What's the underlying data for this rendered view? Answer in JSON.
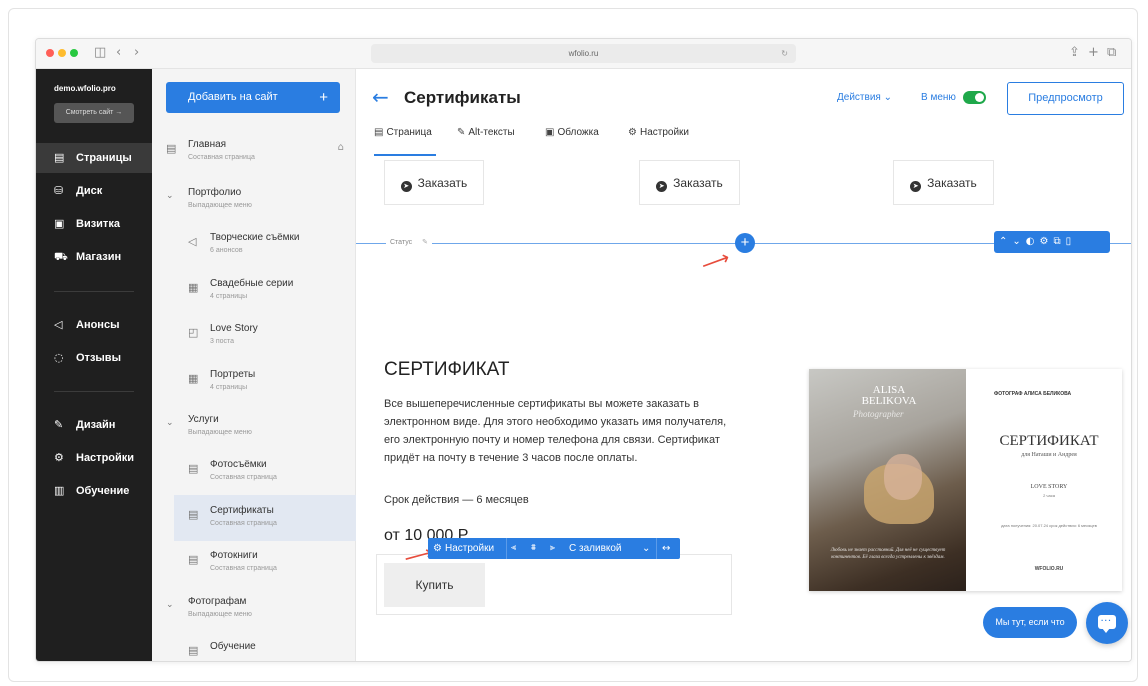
{
  "browser": {
    "url": "wfolio.ru",
    "reload_icon": "reload-icon"
  },
  "sidebar": {
    "domain": "demo.wfolio.pro",
    "view_site": "Смотреть сайт →",
    "nav": [
      {
        "label": "Страницы",
        "icon": "▤"
      },
      {
        "label": "Диск",
        "icon": "⛁"
      },
      {
        "label": "Визитка",
        "icon": "▣"
      },
      {
        "label": "Магазин",
        "icon": "⛟"
      },
      {
        "label": "Анонсы",
        "icon": "◁"
      },
      {
        "label": "Отзывы",
        "icon": "◌"
      },
      {
        "label": "Дизайн",
        "icon": "✎"
      },
      {
        "label": "Настройки",
        "icon": "⚙"
      },
      {
        "label": "Обучение",
        "icon": "▥"
      }
    ]
  },
  "pages": {
    "add_button": "Добавить на сайт",
    "add_plus": "+",
    "items": [
      {
        "title": "Главная",
        "subtitle": "Составная страница"
      },
      {
        "title": "Портфолио",
        "subtitle": "Выпадающее меню"
      },
      {
        "title": "Творческие съёмки",
        "subtitle": "6 анонсов"
      },
      {
        "title": "Свадебные серии",
        "subtitle": "4 страницы"
      },
      {
        "title": "Love Story",
        "subtitle": "3 поста"
      },
      {
        "title": "Портреты",
        "subtitle": "4 страницы"
      },
      {
        "title": "Услуги",
        "subtitle": "Выпадающее меню"
      },
      {
        "title": "Фотосъёмки",
        "subtitle": "Составная страница"
      },
      {
        "title": "Сертификаты",
        "subtitle": "Составная страница"
      },
      {
        "title": "Фотокниги",
        "subtitle": "Составная страница"
      },
      {
        "title": "Фотографам",
        "subtitle": "Выпадающее меню"
      },
      {
        "title": "Обучение",
        "subtitle": ""
      }
    ]
  },
  "header": {
    "back": "←",
    "title": "Сертификаты",
    "actions": "Действия ⌄",
    "in_menu": "В меню",
    "in_menu_on": true,
    "preview": "Предпросмотр"
  },
  "tabs": [
    {
      "label": "Страница",
      "icon": "▤"
    },
    {
      "label": "Alt-тексты",
      "icon": "✎"
    },
    {
      "label": "Обложка",
      "icon": "▣"
    },
    {
      "label": "Настройки",
      "icon": "⚙"
    }
  ],
  "content": {
    "order_buttons": [
      "Заказать",
      "Заказать",
      "Заказать"
    ],
    "status_label": "Статус",
    "add_section": "+",
    "block_tools": "⌃⌄◐⚙⧉▯",
    "cert_title": "СЕРТИФИКАТ",
    "cert_desc": "Все вышеперечисленные сертификаты вы можете заказать в электронном виде. Для этого необходимо указать имя получателя, его электронную почту и номер телефона для связи. Сертификат придёт на почту в течение 3 часов после оплаты.",
    "validity": "Срок действия — 6 месяцев",
    "price": "от 10 000 Р",
    "buy": "Купить",
    "button_toolbar": {
      "settings": "Настройки",
      "fill": "С заливкой"
    }
  },
  "certificate_image": {
    "name": "ALISA BELIKOVA",
    "script": "Photographer",
    "caption": "Любовь не знает расстояний. Для неё не существует континентов. Её глаза всегда устремлены к звёздам.",
    "photographer": "ФОТОГРАФ АЛИСА БЕЛИКОВА",
    "title": "СЕРТИФИКАТ",
    "for": "для Наташи и Андрея",
    "service": "LOVE STORY",
    "hours": "2 часа",
    "dates": "дата получения: 20.07.24 срок действия: 6 месяцев",
    "site": "WFOLIO.RU"
  },
  "help": {
    "bubble": "Мы тут, если что"
  },
  "colors": {
    "accent": "#2a7de1",
    "toggle_on": "#1fa84a",
    "sidebar": "#1f1f1f",
    "arrow": "#e74c3c"
  }
}
